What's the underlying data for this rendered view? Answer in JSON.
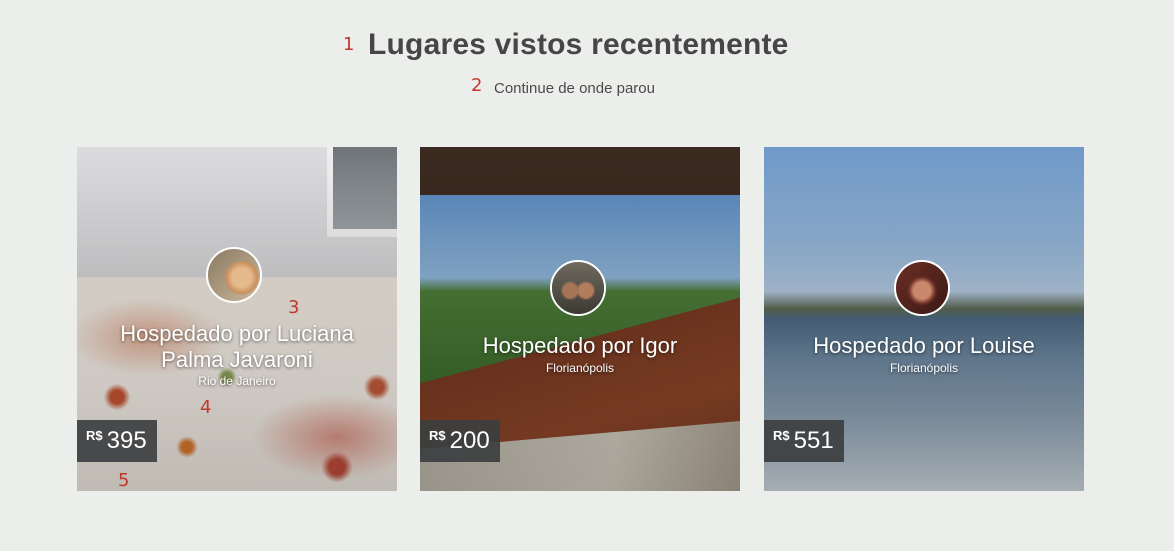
{
  "annotations": [
    "1",
    "2",
    "3",
    "4",
    "5"
  ],
  "section": {
    "title": "Lugares vistos recentemente",
    "subtitle": "Continue de onde parou"
  },
  "listings": [
    {
      "host_label": "Hospedado por Luciana Palma Javaroni",
      "host_line1": "Hospedado por Luciana",
      "host_line2": "Palma Javaroni",
      "city": "Rio de Janeiro",
      "currency": "R$",
      "price": "395"
    },
    {
      "host_label": "Hospedado por Igor",
      "city": "Florianópolis",
      "currency": "R$",
      "price": "200"
    },
    {
      "host_label": "Hospedado por Louise",
      "city": "Florianópolis",
      "currency": "R$",
      "price": "551"
    }
  ],
  "colors": {
    "background": "#eceeeb",
    "title": "#464646",
    "annotation": "#c0392b",
    "price_badge": "#3c3f40"
  }
}
